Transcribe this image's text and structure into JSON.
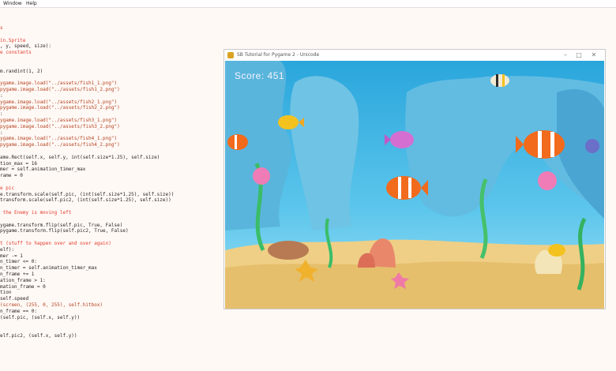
{
  "menu": {
    "items": [
      "Window",
      "Help"
    ]
  },
  "window": {
    "title": "SB Tutorial for Pygame 2 - Unicode"
  },
  "game": {
    "score_text": "Score: 451"
  },
  "colors": {
    "water_top": "#39b4e2",
    "water_bottom": "#7fd3f0",
    "sand": "#efcf86",
    "rock": "#4fa8d0",
    "clownfish": "#f26a1b",
    "yellowfish": "#f3c21f",
    "purplefish": "#d46fd1"
  },
  "icons": [
    "app-icon",
    "minimize-icon",
    "maximize-icon",
    "close-icon"
  ],
  "editor": {
    "lines": [
      {
        "t": "s",
        "c": "kw"
      },
      {
        "t": "",
        "c": "norm"
      },
      {
        "t": "in.Sprite",
        "c": "kw"
      },
      {
        "t": ", y, speed, size):",
        "c": "norm"
      },
      {
        "t": "e constants",
        "c": "kw"
      },
      {
        "t": "",
        "c": "norm"
      },
      {
        "t": "",
        "c": "norm"
      },
      {
        "t": "m.randint(1, 2)",
        "c": "norm"
      },
      {
        "t": "",
        "c": "norm"
      },
      {
        "t": "ygame.image.load(\"../assets/fish1_1.png\")",
        "c": "str"
      },
      {
        "t": "pygame.image.load(\"../assets/fish1_2.png\")",
        "c": "str"
      },
      {
        "t": ":",
        "c": "norm"
      },
      {
        "t": "ygame.image.load(\"../assets/fish2_1.png\")",
        "c": "str"
      },
      {
        "t": "pygame.image.load(\"../assets/fish2_2.png\")",
        "c": "str"
      },
      {
        "t": ":",
        "c": "norm"
      },
      {
        "t": "ygame.image.load(\"../assets/fish3_1.png\")",
        "c": "str"
      },
      {
        "t": "pygame.image.load(\"../assets/fish3_2.png\")",
        "c": "str"
      },
      {
        "t": ":",
        "c": "norm"
      },
      {
        "t": "ygame.image.load(\"../assets/fish4_1.png\")",
        "c": "str"
      },
      {
        "t": "pygame.image.load(\"../assets/fish4_2.png\")",
        "c": "str"
      },
      {
        "t": "",
        "c": "norm"
      },
      {
        "t": "ame.Rect(self.x, self.y, int(self.size*1.25), self.size)",
        "c": "norm"
      },
      {
        "t": "tion_max = 16",
        "c": "norm"
      },
      {
        "t": "mer = self.animation_timer_max",
        "c": "norm"
      },
      {
        "t": "rame = 0",
        "c": "norm"
      },
      {
        "t": "",
        "c": "norm"
      },
      {
        "t": "e pic",
        "c": "kw"
      },
      {
        "t": "e.transform.scale(self.pic, (int(self.size*1.25), self.size))",
        "c": "norm"
      },
      {
        "t": "transform.scale(self.pic2, (int(self.size*1.25), self.size))",
        "c": "norm"
      },
      {
        "t": "",
        "c": "norm"
      },
      {
        "t": " the Enemy is moving left",
        "c": "kw"
      },
      {
        "t": "",
        "c": "norm"
      },
      {
        "t": "ygame.transform.flip(self.pic, True, False)",
        "c": "norm"
      },
      {
        "t": "pygame.transform.flip(self.pic2, True, False)",
        "c": "norm"
      },
      {
        "t": "",
        "c": "norm"
      },
      {
        "t": "t (stuff to happen over and over again)",
        "c": "kw"
      },
      {
        "t": "elf):",
        "c": "norm"
      },
      {
        "t": "mer -= 1",
        "c": "norm"
      },
      {
        "t": "n_timer <= 0:",
        "c": "norm"
      },
      {
        "t": "n_timer = self.animation_timer_max",
        "c": "norm"
      },
      {
        "t": "n_frame += 1",
        "c": "norm"
      },
      {
        "t": "ation_frame > 1:",
        "c": "norm"
      },
      {
        "t": "mation_frame = 0",
        "c": "norm"
      },
      {
        "t": "tion",
        "c": "norm"
      },
      {
        "t": "self.speed",
        "c": "norm"
      },
      {
        "t": "(screen, (255, 0, 255), self.hitbox)",
        "c": "str"
      },
      {
        "t": "n_frame == 0:",
        "c": "norm"
      },
      {
        "t": "(self.pic, (self.x, self.y))",
        "c": "norm"
      },
      {
        "t": "",
        "c": "norm"
      },
      {
        "t": "",
        "c": "norm"
      },
      {
        "t": "elf.pic2, (self.x, self.y))",
        "c": "norm"
      }
    ]
  }
}
